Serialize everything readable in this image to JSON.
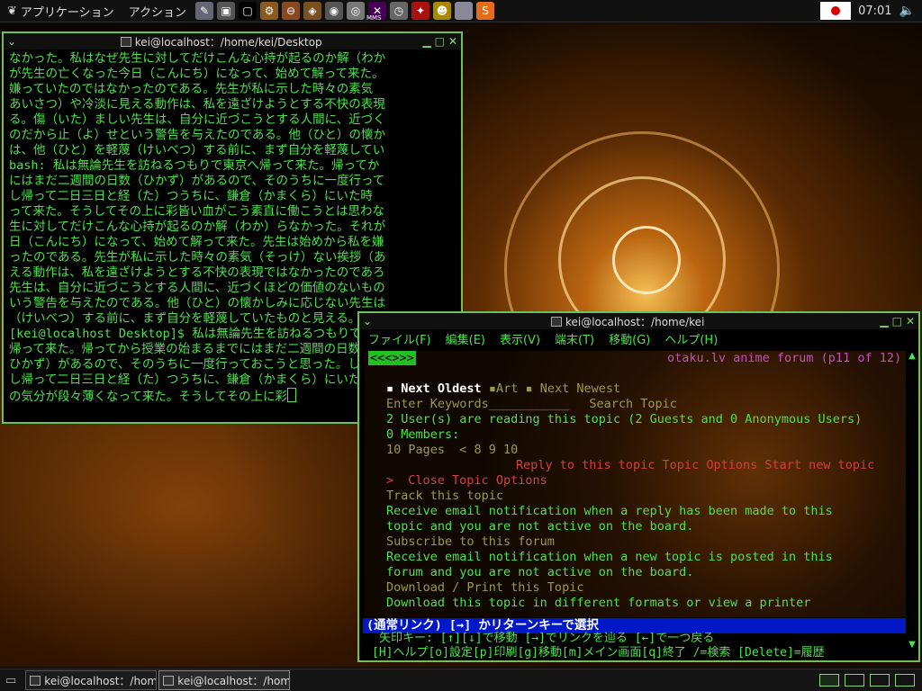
{
  "top_panel": {
    "applications_label": "アプリケーション",
    "actions_label": "アクション",
    "launchers": [
      {
        "name": "text-editor-icon",
        "glyph": "✎",
        "color": "#667"
      },
      {
        "name": "screenshot-icon",
        "glyph": "▣",
        "color": "#555"
      },
      {
        "name": "terminal-icon",
        "glyph": "▢",
        "color": "#000"
      },
      {
        "name": "package-icon",
        "glyph": "⚙",
        "color": "#8a5a20"
      },
      {
        "name": "package-remove-icon",
        "glyph": "⊖",
        "color": "#8a4a20"
      },
      {
        "name": "package-manager-icon",
        "glyph": "◈",
        "color": "#7a5020"
      },
      {
        "name": "camera-icon",
        "glyph": "◉",
        "color": "#555"
      },
      {
        "name": "disc-icon",
        "glyph": "◎",
        "color": "#777"
      },
      {
        "name": "mms-icon",
        "glyph": "✕",
        "color": "#405"
      },
      {
        "name": "clock-app-icon",
        "glyph": "◷",
        "color": "#666"
      },
      {
        "name": "dragon-icon",
        "glyph": "✦",
        "color": "#a11"
      },
      {
        "name": "person-icon",
        "glyph": "☻",
        "color": "#a80"
      },
      {
        "name": "blank-app-icon",
        "glyph": "",
        "color": "#889"
      },
      {
        "name": "skype-icon",
        "glyph": "S",
        "color": "#e46d1b"
      }
    ],
    "mms_text": "MMS",
    "clock": "07:01",
    "flag_color": "#dd0000"
  },
  "term1": {
    "title": "kei@localhost：/home/kei/Desktop",
    "lines": [
      "なかった。私はなぜ先生に対してだけこんな心持が起るのか解（わか",
      "が先生の亡くなった今日（こんにち）になって、始めて解って来た。",
      "嫌っていたのではなかったのである。先生が私に示した時々の素気",
      "あいさつ）や冷淡に見える動作は、私を遠ざけようとする不快の表現",
      "る。傷（いた）ましい先生は、自分に近づこうとする人間に、近づく",
      "のだから止（よ）せという警告を与えたのである。他（ひと）の懐か",
      "は、他（ひと）を軽蔑（けいべつ）する前に、まず自分を軽蔑してい",
      "bash:  私は無論先生を訪ねるつもりで東京へ帰って来た。帰ってか",
      "にはまだ二週間の日数（ひかず）があるので、そのうちに一度行って",
      "し帰って二日三日と経（た）つうちに、鎌倉（かまくら）にいた時",
      "って来た。そうしてその上に彩皆い血がこう素直に働こうとは思わな",
      "生に対してだけこんな心持が起るのか解（わか）らなかった。それが",
      "日（こんにち）になって、始めて解って来た。先生は始めから私を嫌",
      "ったのである。先生が私に示した時々の素気（そっけ）ない挨拶（あ",
      "える動作は、私を遠ざけようとする不快の表現ではなかったのであろ",
      "先生は、自分に近づこうとする人間に、近づくほどの価値のないもの",
      "いう警告を与えたのである。他（ひと）の懐かしみに応じない先生は",
      "（けいべつ）する前に、まず自分を軽蔑していたものと見える。",
      "[kei@localhost Desktop]$  私は無論先生を訪ねるつもりで東京へ",
      "帰って来た。帰ってから授業の始まるまでにはまだ二週間の日数（",
      "ひかず）があるので、そのうちに一度行っておこうと思った。しか",
      "し帰って二日三日と経（た）つうちに、鎌倉（かまくら）にいた時",
      "の気分が段々薄くなって来た。そうしてその上に彩"
    ]
  },
  "term2": {
    "title": "kei@localhost：/home/kei",
    "menu": [
      "ファイル(F)",
      "編集(E)",
      "表示(V)",
      "端末(T)",
      "移動(G)",
      "ヘルプ(H)"
    ],
    "nav_box": "<<<>>>",
    "forum_title": "otaku.lv anime forum (p11 of 12)",
    "next_oldest": "Next Oldest",
    "art": "Art",
    "next_newest": "Next Newest",
    "enter_keywords": "Enter Keywords___________",
    "search_topic": "Search Topic",
    "readers": "2 User(s) are reading this topic (2 Guests and 0 Anonymous Users)",
    "members": "0 Members:",
    "pages_prefix": "10 Pages",
    "pages_arrow": "<",
    "pages_nums": "8 9 10",
    "topic_actions": "Reply to this topic Topic Options Start new topic",
    "close_options_arrow": ">",
    "close_options": "Close Topic Options",
    "track_topic": "Track this topic",
    "track_desc_1": "Receive  email  notification  when  a reply has been made to this",
    "track_desc_2": "topic and you are not active on the board.",
    "subscribe": "Subscribe to this forum",
    "sub_desc_1": "Receive  email  notification  when  a new topic is posted in this",
    "sub_desc_2": "forum and you are not active on the board.",
    "download": "Download / Print this Topic",
    "download_desc": "Download  this  topic  in  different  formats  or  view a printer",
    "status": "(通常リンク) [→] かリターンキーで選択",
    "help1": "矢印キー: [↑][↓]で移動 [→]でリンクを辿る [←]で一つ戻る",
    "help2": "[H]ヘルプ[o]設定[p]印刷[g]移動[m]メイン画面[q]終了 /=検索 [Delete]=履歴"
  },
  "taskbar": {
    "tasks": [
      {
        "label": "kei@localhost：/home/kei/Desktop"
      },
      {
        "label": "kei@localhost：/home/kei"
      }
    ]
  }
}
